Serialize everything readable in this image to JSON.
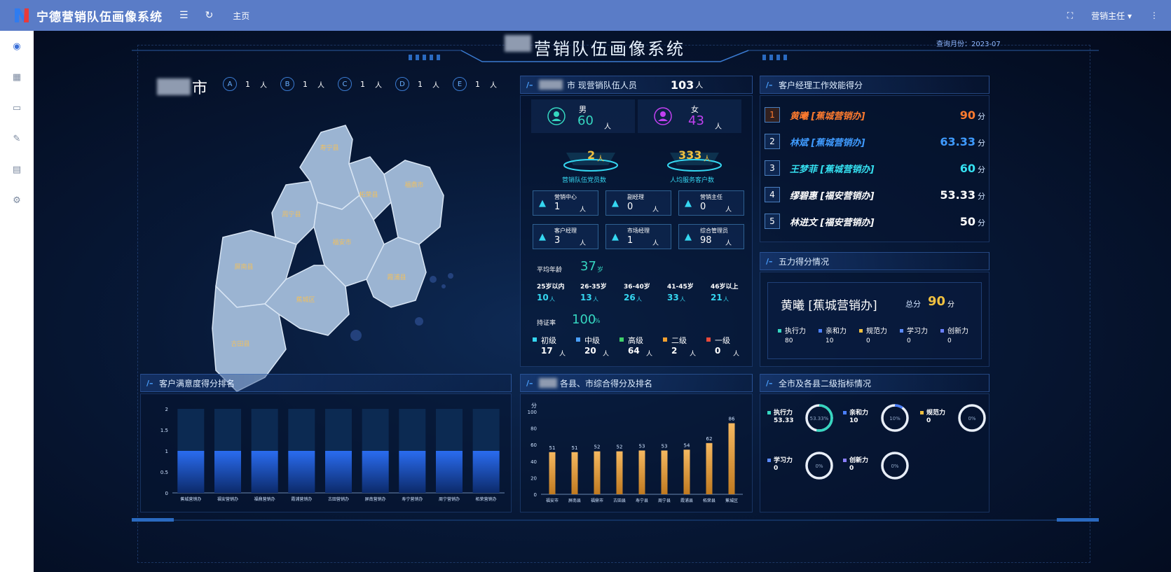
{
  "app": {
    "title": "宁德营销队伍画像系统",
    "home": "主页",
    "user": "营销主任"
  },
  "dashboard": {
    "title": "营销队伍画像系统",
    "query_date": "查询月份：2023-07"
  },
  "map": {
    "city": "市",
    "levels": [
      {
        "letter": "A",
        "count": "1",
        "unit": "人"
      },
      {
        "letter": "B",
        "count": "1",
        "unit": "人"
      },
      {
        "letter": "C",
        "count": "1",
        "unit": "人"
      },
      {
        "letter": "D",
        "count": "1",
        "unit": "人"
      },
      {
        "letter": "E",
        "count": "1",
        "unit": "人"
      }
    ],
    "regions": [
      "寿宁县",
      "周宁县",
      "柘荣县",
      "福鼎市",
      "福安市",
      "屏南县",
      "霞浦县",
      "蕉城区",
      "古田县"
    ]
  },
  "staff": {
    "header_label": "市 现营销队伍人员",
    "total": "103",
    "total_unit": "人",
    "male_label": "男",
    "male_count": "60",
    "male_unit": "人",
    "female_label": "女",
    "female_count": "43",
    "female_unit": "人",
    "team_count": "2",
    "team_unit": "人",
    "team_label": "营销队伍党员数",
    "avg_customers": "333",
    "avg_customers_unit": "人",
    "avg_customers_label": "人均服务客户数",
    "roles": [
      {
        "label": "营销中心",
        "count": "1",
        "unit": "人"
      },
      {
        "label": "副经理",
        "count": "0",
        "unit": "人"
      },
      {
        "label": "营销主任",
        "count": "0",
        "unit": "人"
      },
      {
        "label": "客户经理",
        "count": "3",
        "unit": "人"
      },
      {
        "label": "市场经理",
        "count": "1",
        "unit": "人"
      },
      {
        "label": "综合管理员",
        "count": "98",
        "unit": "人"
      }
    ],
    "avg_age_label": "平均年龄",
    "avg_age": "37",
    "avg_age_unit": "岁",
    "age_groups": [
      {
        "label": "25岁以内",
        "count": "10",
        "unit": "人"
      },
      {
        "label": "26-35岁",
        "count": "13",
        "unit": "人"
      },
      {
        "label": "36-40岁",
        "count": "26",
        "unit": "人"
      },
      {
        "label": "41-45岁",
        "count": "33",
        "unit": "人"
      },
      {
        "label": "46岁以上",
        "count": "21",
        "unit": "人"
      }
    ],
    "cert_label": "持证率",
    "cert_rate": "100",
    "cert_unit": "%",
    "cert_levels": [
      {
        "label": "初级",
        "count": "17",
        "unit": "人",
        "color": "#35d6f0"
      },
      {
        "label": "中级",
        "count": "20",
        "unit": "人",
        "color": "#4aa0ff"
      },
      {
        "label": "高级",
        "count": "64",
        "unit": "人",
        "color": "#3fcf6a"
      },
      {
        "label": "二级",
        "count": "2",
        "unit": "人",
        "color": "#f0a030"
      },
      {
        "label": "一级",
        "count": "0",
        "unit": "人",
        "color": "#e84a3a"
      }
    ]
  },
  "efficiency": {
    "title": "客户经理工作效能得分",
    "items": [
      {
        "rank": "1",
        "name": "黄曦 [蕉城营销办]",
        "score": "90",
        "unit": "分",
        "color": "#ff7b2e"
      },
      {
        "rank": "2",
        "name": "林斌 [蕉城营销办]",
        "score": "63.33",
        "unit": "分",
        "color": "#3f9bff"
      },
      {
        "rank": "3",
        "name": "王梦菲 [蕉城营销办]",
        "score": "60",
        "unit": "分",
        "color": "#35e0f0"
      },
      {
        "rank": "4",
        "name": "缪碧惠 [福安营销办]",
        "score": "53.33",
        "unit": "分",
        "color": "#ffffff"
      },
      {
        "rank": "5",
        "name": "林进文 [福安营销办]",
        "score": "50",
        "unit": "分",
        "color": "#ffffff"
      }
    ]
  },
  "five_power": {
    "title": "五力得分情况",
    "person": "黄曦 [蕉城营销办]",
    "total_label": "总分",
    "total": "90",
    "unit": "分",
    "items": [
      {
        "label": "执行力",
        "value": "80",
        "color": "#35d6c0"
      },
      {
        "label": "亲和力",
        "value": "10",
        "color": "#4a7fff"
      },
      {
        "label": "规范力",
        "value": "0",
        "color": "#f0c040"
      },
      {
        "label": "学习力",
        "value": "0",
        "color": "#5a8aff"
      },
      {
        "label": "创新力",
        "value": "0",
        "color": "#6a7fff"
      }
    ]
  },
  "satisfaction": {
    "title": "客户满意度得分排名"
  },
  "county": {
    "title": "各县、市综合得分及排名"
  },
  "secondary": {
    "title": "全市及各县二级指标情况",
    "rings": [
      {
        "label": "执行力",
        "value": "53.33",
        "pct": "53.33%",
        "fraction": 0.5333,
        "color": "#35d6c0"
      },
      {
        "label": "亲和力",
        "value": "10",
        "pct": "10%",
        "fraction": 0.1,
        "color": "#4a7fff"
      },
      {
        "label": "规范力",
        "value": "0",
        "pct": "0%",
        "fraction": 0,
        "color": "#f0c040"
      },
      {
        "label": "学习力",
        "value": "0",
        "pct": "0%",
        "fraction": 0,
        "color": "#5a8aff"
      },
      {
        "label": "创新力",
        "value": "0",
        "pct": "0%",
        "fraction": 0,
        "color": "#8a7fff"
      }
    ]
  },
  "chart_data": [
    {
      "type": "bar",
      "categories": [
        "蕉城营销办",
        "福安营销办",
        "福鼎营销办",
        "霞浦营销办",
        "古田营销办",
        "屏南营销办",
        "寿宁营销办",
        "周宁营销办",
        "柘荣营销办"
      ],
      "values": [
        1,
        1,
        1,
        1,
        1,
        1,
        1,
        1,
        1
      ],
      "ylim": [
        0,
        2
      ],
      "yticks": [
        "0",
        "0.5",
        "1",
        "1.5",
        "2"
      ],
      "title": "客户满意度得分排名"
    },
    {
      "type": "bar",
      "categories": [
        "福安市",
        "屏南县",
        "福鼎市",
        "古田县",
        "寿宁县",
        "周宁县",
        "霞浦县",
        "柘荣县",
        "蕉城区"
      ],
      "values": [
        51,
        51,
        52,
        52,
        53,
        53,
        54,
        62,
        86
      ],
      "ylim": [
        0,
        100
      ],
      "yticks": [
        "0",
        "20",
        "40",
        "60",
        "80",
        "100"
      ],
      "ylabel": "分",
      "title": "各县、市综合得分及排名"
    }
  ]
}
